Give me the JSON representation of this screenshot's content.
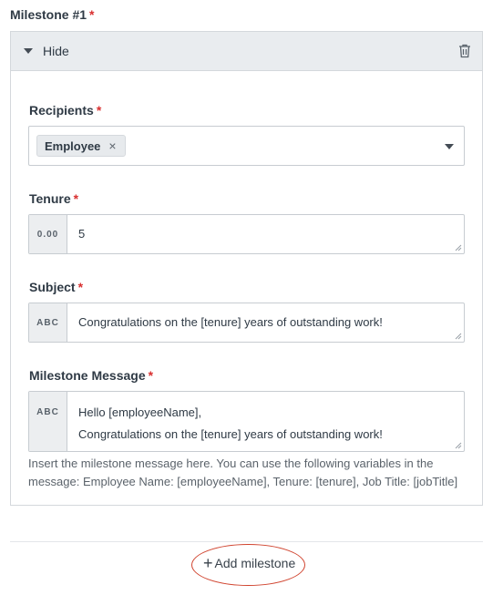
{
  "milestone": {
    "title": "Milestone #1",
    "required_mark": "*",
    "toggle_label": "Hide"
  },
  "recipients": {
    "label": "Recipients",
    "tags": [
      "Employee"
    ],
    "remove_glyph": "×"
  },
  "tenure": {
    "label": "Tenure",
    "addon": "0.00",
    "value": "5"
  },
  "subject": {
    "label": "Subject",
    "addon": "ABC",
    "value": "Congratulations on the [tenure] years of outstanding work!"
  },
  "message": {
    "label": "Milestone Message",
    "addon": "ABC",
    "line1": "Hello [employeeName],",
    "line2": "Congratulations on the [tenure] years of outstanding work!",
    "help": "Insert the milestone message here. You can use the following variables in the message: Employee Name: [employeeName], Tenure: [tenure], Job Title: [jobTitle]"
  },
  "add_milestone": {
    "plus": "+",
    "label": "Add milestone"
  },
  "colors": {
    "required": "#d93030",
    "annotation_circle": "#d0432e",
    "panel_header": "#e9ecef"
  }
}
